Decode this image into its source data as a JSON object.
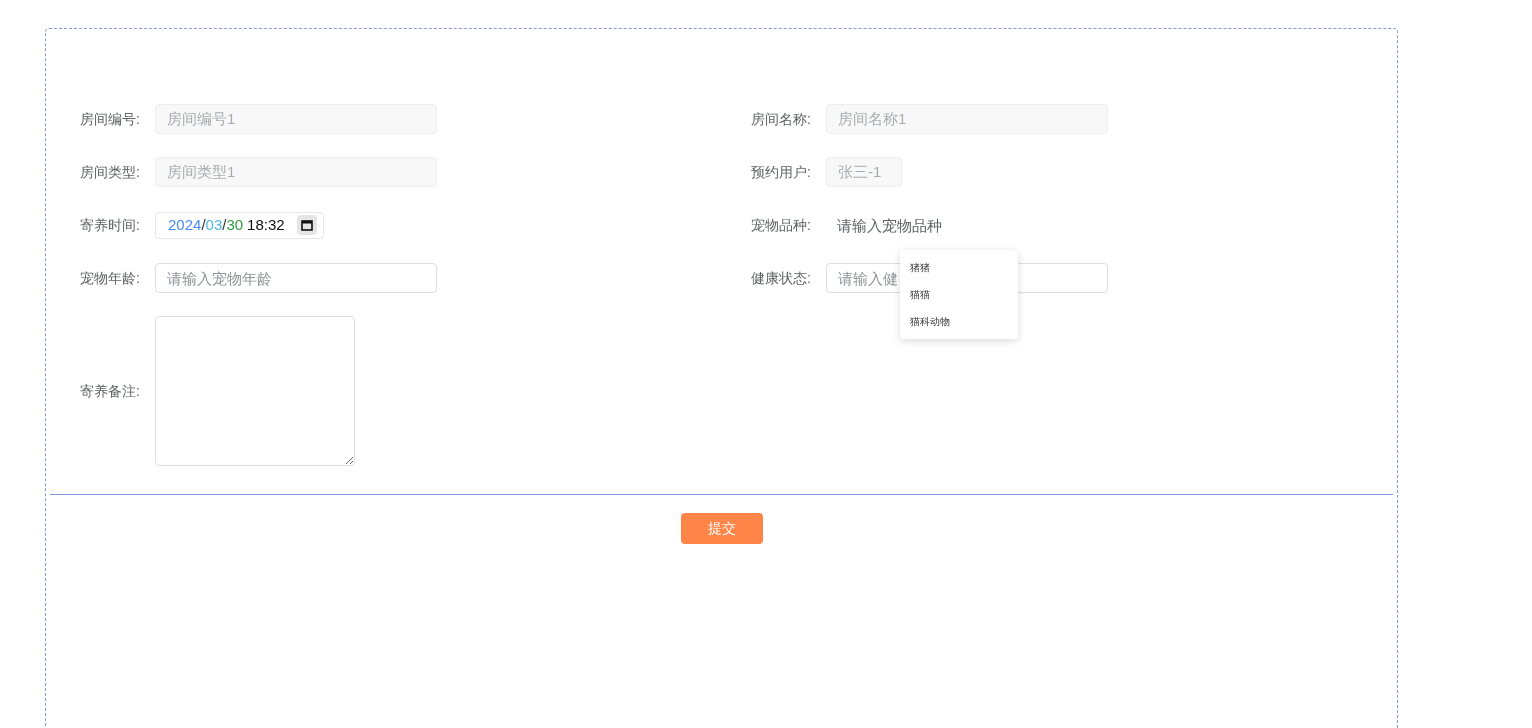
{
  "fields": [
    {
      "label": "房间编号:",
      "kind": "readonly",
      "value": "房间编号1"
    },
    {
      "label": "房间名称:",
      "kind": "readonly",
      "value": "房间名称1"
    },
    {
      "label": "房间类型:",
      "kind": "readonly",
      "value": "房间类型1"
    },
    {
      "label": "预约用户:",
      "kind": "readonly_short",
      "value": "张三-1"
    },
    {
      "label": "寄养时间:",
      "kind": "datetime",
      "parts": [
        {
          "text": "2024",
          "color": "#4a8af4"
        },
        {
          "text": "/",
          "color": "#333333"
        },
        {
          "text": "03",
          "color": "#4fb6e8"
        },
        {
          "text": "/",
          "color": "#333333"
        },
        {
          "text": "30",
          "color": "#2e9e3e"
        },
        {
          "text": "18:32",
          "color": "#111111"
        }
      ]
    },
    {
      "label": "宠物品种:",
      "kind": "autocomplete",
      "placeholder": "请输入宠物品种",
      "suggestions": [
        "猪猪",
        "猫猫",
        "猫科动物"
      ]
    },
    {
      "label": "宠物年龄:",
      "kind": "text",
      "placeholder": "请输入宠物年龄"
    },
    {
      "label": "健康状态:",
      "kind": "text",
      "placeholder": "请输入健"
    },
    {
      "label": "寄养备注:",
      "kind": "textarea"
    }
  ],
  "submit": "提交"
}
